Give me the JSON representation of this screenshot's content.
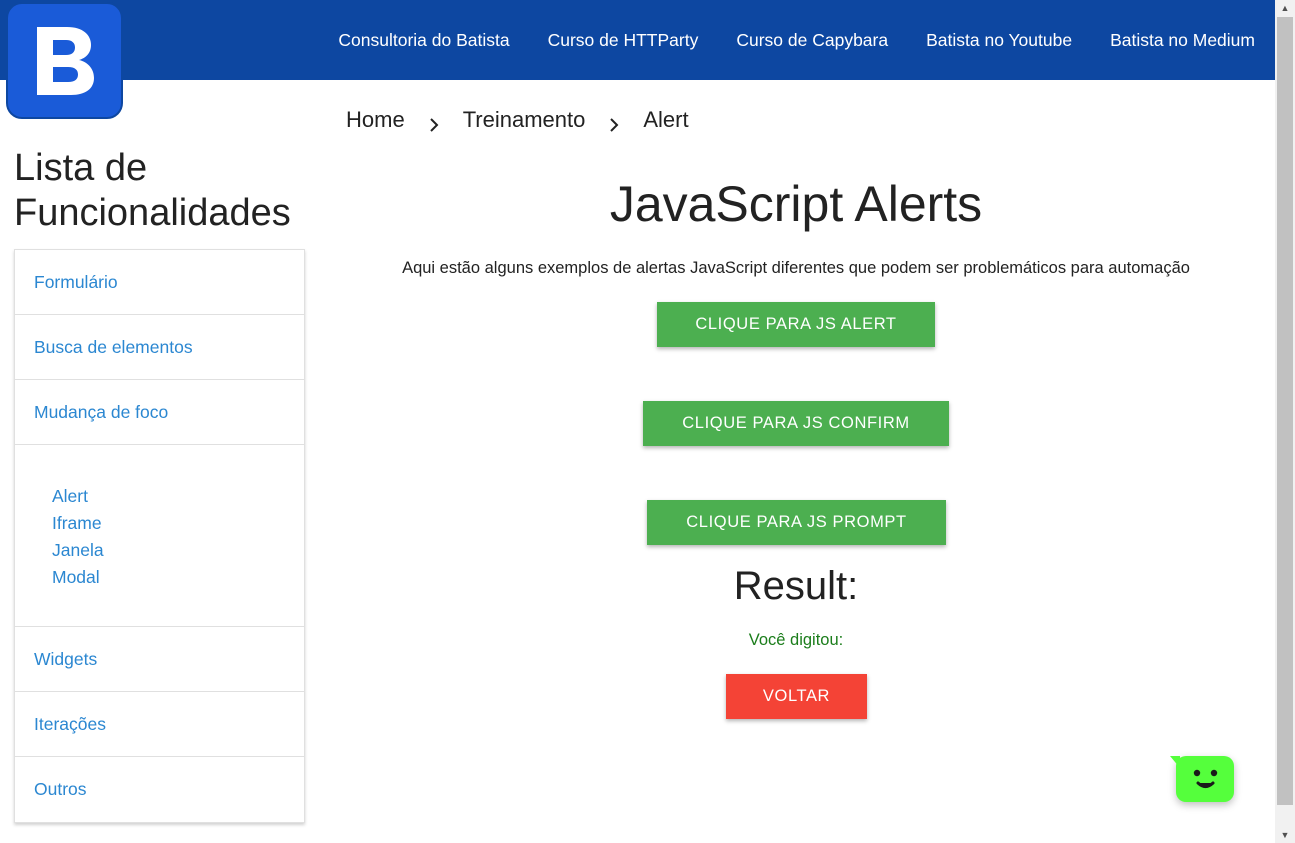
{
  "logo": {
    "letter": "B"
  },
  "nav": {
    "links": [
      "Consultoria do Batista",
      "Curso de HTTParty",
      "Curso de Capybara",
      "Batista no Youtube",
      "Batista no Medium"
    ]
  },
  "sidebar": {
    "title_line1": "Lista de",
    "title_line2": "Funcionalidades",
    "items": [
      "Formulário",
      "Busca de elementos",
      "Mudança de foco"
    ],
    "subitems": [
      "Alert",
      "Iframe",
      "Janela",
      "Modal"
    ],
    "items_after": [
      "Widgets",
      "Iterações",
      "Outros"
    ]
  },
  "breadcrumb": {
    "items": [
      "Home",
      "Treinamento",
      "Alert"
    ]
  },
  "main": {
    "title": "JavaScript Alerts",
    "subtitle": "Aqui estão alguns exemplos de alertas JavaScript diferentes que podem ser problemáticos para automação",
    "buttons": {
      "alert": "CLIQUE PARA JS ALERT",
      "confirm": "CLIQUE PARA JS CONFIRM",
      "prompt": "CLIQUE PARA JS PROMPT"
    },
    "result_title": "Result:",
    "result_text": "Você digitou:",
    "back_button": "VOLTAR"
  },
  "colors": {
    "nav_bg": "#0d47a1",
    "link": "#2b87d1",
    "green_button": "#4caf50",
    "red_button": "#f44336",
    "result_text": "#1b7d1b",
    "chat_widget": "#55ff3c"
  },
  "icons": {
    "breadcrumb_separator": "chevron-right-icon",
    "chat": "chat-smiley-icon"
  }
}
